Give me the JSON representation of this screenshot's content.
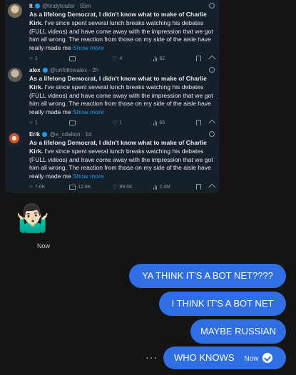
{
  "tweets": [
    {
      "name": "lt",
      "handle": "@lindytrader",
      "time": "55m",
      "lead": "As a lifelong Democrat, I didn't know what to make of Charlie Kirk.",
      "body": " I've since spent several lunch breaks watching his debates (FULL videos) and have come away with the impression that we got him all wrong. The reaction from those on my side of the aisle have really made me ",
      "more": "Show more",
      "replies": "1",
      "reposts": "",
      "likes": "4",
      "views": "82"
    },
    {
      "name": "alex",
      "handle": "@unfollowalex",
      "time": "2h",
      "lead": "As a lifelong Democrat, I didn't know what to make of Charlie Kirk.",
      "body": " I've since spent several lunch breaks watching his debates (FULL videos) and have come away with the impression that we got him all wrong. The reaction from those on my side of the aisle have really made me ",
      "more": "Show more",
      "replies": "1",
      "reposts": "",
      "likes": "1",
      "views": "65"
    },
    {
      "name": "Erik",
      "handle": "@e_cdalton",
      "time": "1d",
      "lead": "As a lifelong Democrat, I didn't know what to make of Charlie Kirk.",
      "body": " I've since spent several lunch breaks watching his debates (FULL videos) and have come away with the impression that we got him all wrong. The reaction from those on my side of the aisle have really made me ",
      "more": "Show more",
      "replies": "7.6K",
      "reposts": "12.8K",
      "likes": "99.6K",
      "views": "2.4M"
    }
  ],
  "reaction": {
    "emoji": "🤷🏻‍♂️",
    "timestamp": "Now"
  },
  "messages": [
    "YA THINK IT'S A BOT NET????",
    "I THINK IT'S A BOT NET",
    "MAYBE RUSSIAN",
    "WHO KNOWS"
  ],
  "last_message_time": "Now",
  "more_dots": "···",
  "colors": {
    "bubble": "#2f6fe3",
    "link": "#1d9bf0",
    "tweet_bg": "#15202b",
    "page_bg": "#141414"
  }
}
